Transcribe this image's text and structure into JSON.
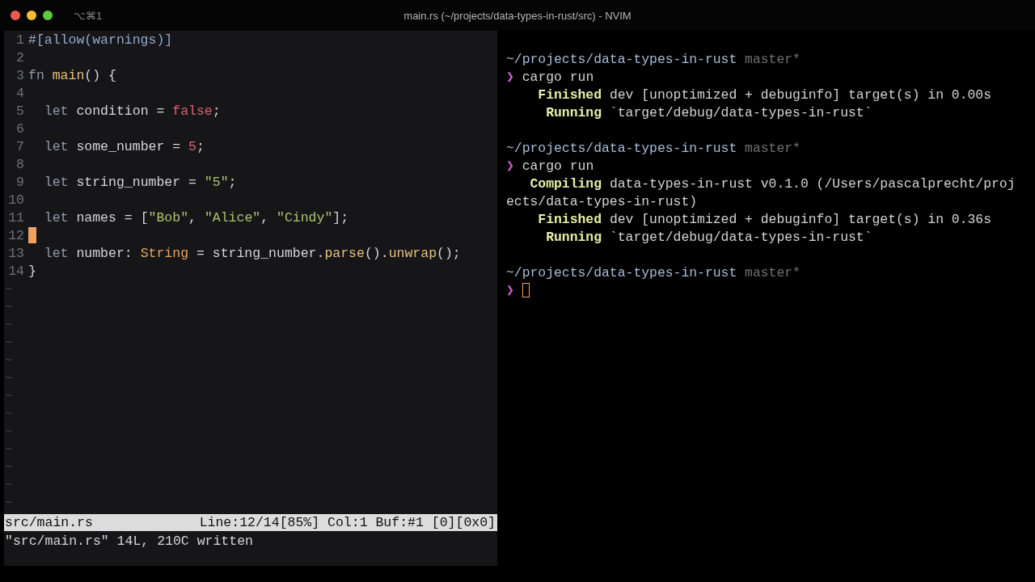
{
  "window": {
    "shortcut": "⌥⌘1",
    "title": "main.rs (~/projects/data-types-in-rust/src) - NVIM"
  },
  "editor": {
    "lines": [
      {
        "number": "1",
        "cursor": false,
        "tokens": [
          {
            "kind": "attr",
            "text": "#[allow(warnings)]"
          }
        ]
      },
      {
        "number": "2",
        "cursor": false
      },
      {
        "number": "3",
        "cursor": false,
        "tokens": [
          {
            "kind": "keyword",
            "text": "fn "
          },
          {
            "kind": "func",
            "text": "main"
          },
          {
            "kind": "plain",
            "text": "() {"
          }
        ]
      },
      {
        "number": "4",
        "cursor": false
      },
      {
        "number": "5",
        "cursor": false,
        "tokens": [
          {
            "kind": "keyword",
            "text": "  let"
          },
          {
            "kind": "plain",
            "text": " condition = "
          },
          {
            "kind": "bool",
            "text": "false"
          },
          {
            "kind": "plain",
            "text": ";"
          }
        ]
      },
      {
        "number": "6",
        "cursor": false
      },
      {
        "number": "7",
        "cursor": false,
        "tokens": [
          {
            "kind": "keyword",
            "text": "  let"
          },
          {
            "kind": "plain",
            "text": " some_number = "
          },
          {
            "kind": "number",
            "text": "5"
          },
          {
            "kind": "plain",
            "text": ";"
          }
        ]
      },
      {
        "number": "8",
        "cursor": false
      },
      {
        "number": "9",
        "cursor": false,
        "tokens": [
          {
            "kind": "keyword",
            "text": "  let"
          },
          {
            "kind": "plain",
            "text": " string_number = "
          },
          {
            "kind": "string",
            "text": "\"5\""
          },
          {
            "kind": "plain",
            "text": ";"
          }
        ]
      },
      {
        "number": "10",
        "cursor": false
      },
      {
        "number": "11",
        "cursor": false,
        "tokens": [
          {
            "kind": "keyword",
            "text": "  let"
          },
          {
            "kind": "plain",
            "text": " names = ["
          },
          {
            "kind": "string",
            "text": "\"Bob\""
          },
          {
            "kind": "plain",
            "text": ", "
          },
          {
            "kind": "string",
            "text": "\"Alice\""
          },
          {
            "kind": "plain",
            "text": ", "
          },
          {
            "kind": "string",
            "text": "\"Cindy\""
          },
          {
            "kind": "plain",
            "text": "];"
          }
        ]
      },
      {
        "number": "12",
        "cursor": true
      },
      {
        "number": "13",
        "cursor": false,
        "tokens": [
          {
            "kind": "keyword",
            "text": "  let"
          },
          {
            "kind": "plain",
            "text": " number: "
          },
          {
            "kind": "type",
            "text": "String"
          },
          {
            "kind": "plain",
            "text": " = string_number."
          },
          {
            "kind": "func",
            "text": "parse"
          },
          {
            "kind": "plain",
            "text": "()."
          },
          {
            "kind": "func",
            "text": "unwrap"
          },
          {
            "kind": "plain",
            "text": "();"
          }
        ]
      },
      {
        "number": "14",
        "cursor": false,
        "tokens": [
          {
            "kind": "plain",
            "text": "}"
          }
        ]
      }
    ],
    "tildes": [
      "~",
      "~",
      "~",
      "~",
      "~",
      "~",
      "~",
      "~",
      "~",
      "~",
      "~",
      "~",
      "~"
    ],
    "status_line": {
      "file": "src/main.rs",
      "position": "Line:12/14[85%] Col:1 Buf:#1 [0][0x0]"
    },
    "message": "\"src/main.rs\" 14L, 210C written"
  },
  "terminal": {
    "lines": [
      {
        "cursor": false
      },
      {
        "cursor": false,
        "segments": [
          {
            "kind": "path",
            "text": "~/projects/data-types-in-rust"
          },
          {
            "kind": "branch",
            "text": " master*"
          }
        ]
      },
      {
        "cursor": false,
        "segments": [
          {
            "kind": "prompt",
            "text": "❯"
          },
          {
            "kind": "plain",
            "text": " cargo run"
          }
        ]
      },
      {
        "cursor": false,
        "segments": [
          {
            "kind": "status",
            "text": "    Finished"
          },
          {
            "kind": "plain",
            "text": " dev [unoptimized + debuginfo] target(s) in 0.00s"
          }
        ]
      },
      {
        "cursor": false,
        "segments": [
          {
            "kind": "status",
            "text": "     Running"
          },
          {
            "kind": "plain",
            "text": " `target/debug/data-types-in-rust`"
          }
        ]
      },
      {
        "cursor": false
      },
      {
        "cursor": false,
        "segments": [
          {
            "kind": "path",
            "text": "~/projects/data-types-in-rust"
          },
          {
            "kind": "branch",
            "text": " master*"
          }
        ]
      },
      {
        "cursor": false,
        "segments": [
          {
            "kind": "prompt",
            "text": "❯"
          },
          {
            "kind": "plain",
            "text": " cargo run"
          }
        ]
      },
      {
        "cursor": false,
        "segments": [
          {
            "kind": "status",
            "text": "   Compiling"
          },
          {
            "kind": "plain",
            "text": " data-types-in-rust v0.1.0 (/Users/pascalprecht/proj"
          }
        ]
      },
      {
        "cursor": false,
        "segments": [
          {
            "kind": "plain",
            "text": "ects/data-types-in-rust)"
          }
        ]
      },
      {
        "cursor": false,
        "segments": [
          {
            "kind": "status",
            "text": "    Finished"
          },
          {
            "kind": "plain",
            "text": " dev [unoptimized + debuginfo] target(s) in 0.36s"
          }
        ]
      },
      {
        "cursor": false,
        "segments": [
          {
            "kind": "status",
            "text": "     Running"
          },
          {
            "kind": "plain",
            "text": " `target/debug/data-types-in-rust`"
          }
        ]
      },
      {
        "cursor": false
      },
      {
        "cursor": false,
        "segments": [
          {
            "kind": "path",
            "text": "~/projects/data-types-in-rust"
          },
          {
            "kind": "branch",
            "text": " master*"
          }
        ]
      },
      {
        "cursor": true,
        "segments": [
          {
            "kind": "prompt",
            "text": "❯"
          }
        ]
      }
    ]
  }
}
